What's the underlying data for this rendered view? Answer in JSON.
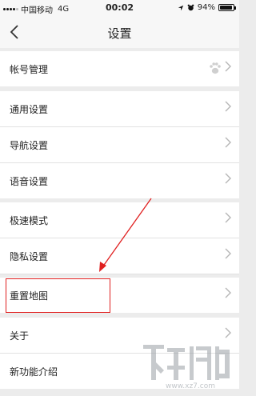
{
  "status": {
    "carrier": "中国移动",
    "network": "4G",
    "time": "00:02",
    "battery": "94%",
    "battery_level": 0.94
  },
  "nav": {
    "title": "设置"
  },
  "rows": [
    {
      "label": "帐号管理"
    },
    {
      "label": "通用设置"
    },
    {
      "label": "导航设置"
    },
    {
      "label": "语音设置"
    },
    {
      "label": "极速模式"
    },
    {
      "label": "隐私设置"
    },
    {
      "label": "重置地图"
    },
    {
      "label": "关于"
    },
    {
      "label": "新功能介绍"
    }
  ],
  "colors": {
    "background": "#ececec",
    "row_bg": "#ffffff",
    "annotation": "#e02020",
    "chevron": "#b5b5b5"
  },
  "icons": [
    "back-chevron-icon",
    "paw-icon",
    "chevron-right-icon",
    "alarm-icon",
    "location-icon",
    "battery-icon"
  ]
}
